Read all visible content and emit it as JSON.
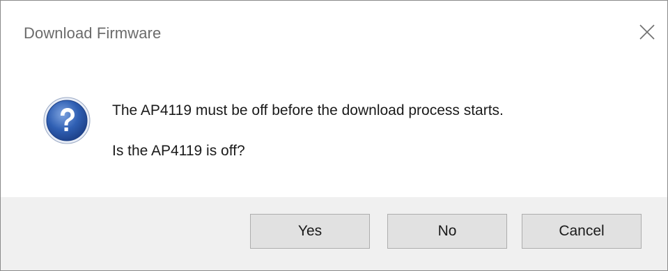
{
  "window": {
    "title": "Download Firmware",
    "close_icon": "close-icon"
  },
  "message": {
    "icon": "question-icon",
    "line1": "The AP4119 must be off before the download process starts.",
    "line2": "Is the AP4119 is off?"
  },
  "buttons": {
    "yes": "Yes",
    "no": "No",
    "cancel": "Cancel"
  },
  "colors": {
    "icon_blue": "#2f5fb3",
    "footer_bg": "#f0f0f0",
    "button_bg": "#e1e1e1",
    "button_border": "#adadad"
  }
}
